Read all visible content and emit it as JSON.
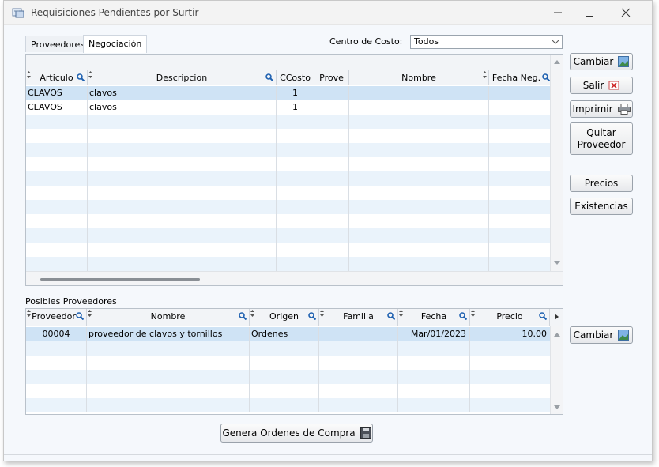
{
  "window": {
    "title": "Requisiciones Pendientes por Surtir"
  },
  "tabs": [
    {
      "label": "Proveedores",
      "active": false
    },
    {
      "label": "Negociación",
      "active": true
    }
  ],
  "centro_costo": {
    "label": "Centro de Costo:",
    "value": "Todos"
  },
  "top_grid": {
    "columns": [
      "Articulo",
      "Descripcion",
      "CCosto",
      "Prove",
      "Nombre",
      "Fecha Neg."
    ],
    "rows": [
      {
        "articulo": "CLAVOS",
        "descripcion": "clavos",
        "ccosto": "1",
        "prove": "",
        "nombre": "",
        "fecha": ""
      },
      {
        "articulo": "CLAVOS",
        "descripcion": "clavos",
        "ccosto": "1",
        "prove": "",
        "nombre": "",
        "fecha": ""
      }
    ]
  },
  "side_buttons": {
    "cambiar": "Cambiar",
    "salir": "Salir",
    "imprimir": "Imprimir",
    "quitar_line1": "Quitar",
    "quitar_line2": "Proveedor",
    "precios": "Precios",
    "existencias": "Existencias"
  },
  "bottom": {
    "title": "Posibles Proveedores",
    "columns": [
      "Proveedor",
      "Nombre",
      "Origen",
      "Familia",
      "Fecha",
      "Precio"
    ],
    "rows": [
      {
        "proveedor": "00004",
        "nombre": "proveedor de clavos y tornillos",
        "origen": "Ordenes",
        "familia": "",
        "fecha": "Mar/01/2023",
        "precio": "10.00"
      }
    ],
    "cambiar": "Cambiar"
  },
  "genera_button": "Genera Ordenes de Compra"
}
